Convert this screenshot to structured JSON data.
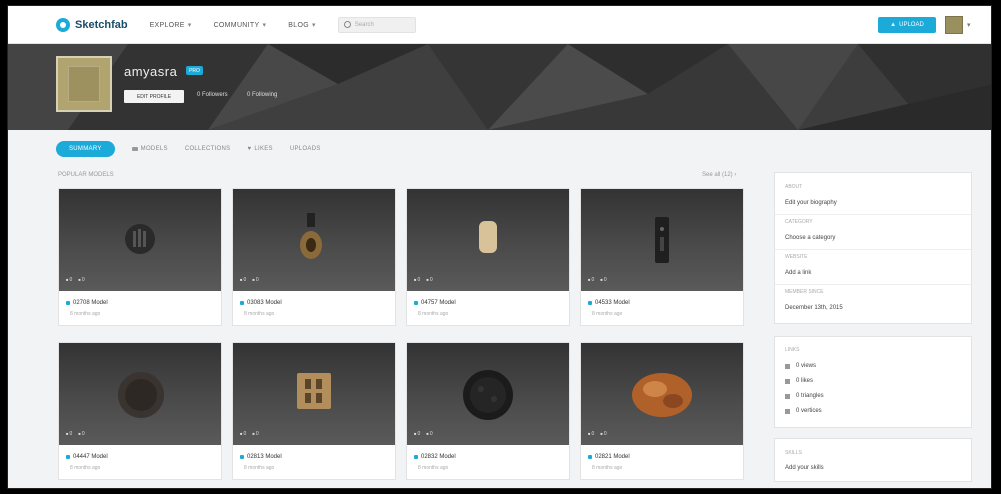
{
  "header": {
    "logo_text": "Sketchfab",
    "nav": [
      {
        "label": "EXPLORE"
      },
      {
        "label": "COMMUNITY"
      },
      {
        "label": "BLOG"
      }
    ],
    "search_placeholder": "Search",
    "upload_label": "UPLOAD",
    "caret": "▾"
  },
  "profile": {
    "username": "amyasra",
    "badge": "PRO",
    "edit_label": "EDIT PROFILE",
    "followers": "0 Followers",
    "following": "0 Following"
  },
  "tabs": [
    {
      "label": "SUMMARY",
      "active": true
    },
    {
      "label": "MODELS",
      "active": false
    },
    {
      "label": "COLLECTIONS",
      "active": false
    },
    {
      "label": "LIKES",
      "active": false
    },
    {
      "label": "UPLOADS",
      "active": false
    }
  ],
  "section": {
    "label": "POPULAR MODELS",
    "see_all": "See all (12) ›"
  },
  "models": [
    {
      "title": "02708 Model",
      "sub": "8 months ago",
      "views": "0",
      "likes": "0"
    },
    {
      "title": "03083 Model",
      "sub": "8 months ago",
      "views": "0",
      "likes": "0"
    },
    {
      "title": "04757 Model",
      "sub": "8 months ago",
      "views": "0",
      "likes": "0"
    },
    {
      "title": "04533 Model",
      "sub": "8 months ago",
      "views": "0",
      "likes": "0"
    },
    {
      "title": "04447 Model",
      "sub": "8 months ago",
      "views": "0",
      "likes": "0"
    },
    {
      "title": "02813 Model",
      "sub": "8 months ago",
      "views": "0",
      "likes": "0"
    },
    {
      "title": "02832 Model",
      "sub": "8 months ago",
      "views": "0",
      "likes": "0"
    },
    {
      "title": "02821 Model",
      "sub": "8 months ago",
      "views": "0",
      "likes": "0"
    }
  ],
  "about": {
    "about_label": "ABOUT",
    "bio": "Edit your biography",
    "category_label": "CATEGORY",
    "category": "Choose a category",
    "website_label": "WEBSITE",
    "website": "Add a link",
    "member_label": "MEMBER SINCE",
    "member_since": "December 13th, 2015"
  },
  "links": {
    "label": "LINKS",
    "items": [
      {
        "label": "0 views"
      },
      {
        "label": "0 likes"
      },
      {
        "label": "0 triangles"
      },
      {
        "label": "0 vertices"
      }
    ]
  },
  "skills": {
    "label": "SKILLS",
    "value": "Add your skills"
  },
  "colors": {
    "accent": "#1caad9",
    "cover": "#3b3b3b",
    "page_bg": "#f2f3f5"
  }
}
